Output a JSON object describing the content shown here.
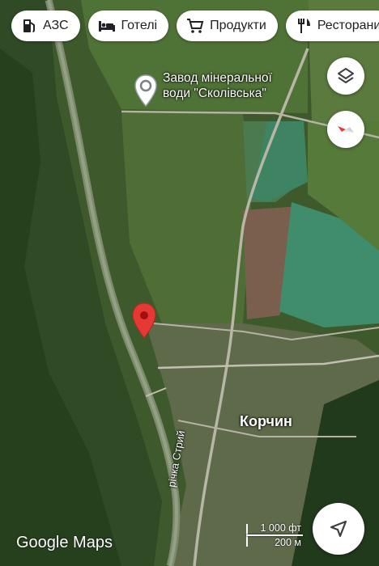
{
  "filters": [
    {
      "label": "АЗС",
      "icon": "gas-station-icon"
    },
    {
      "label": "Готелі",
      "icon": "bed-icon"
    },
    {
      "label": "Продукти",
      "icon": "shopping-cart-icon"
    },
    {
      "label": "Ресторани",
      "icon": "restaurant-icon"
    }
  ],
  "poi": {
    "line1": "Завод мінеральної",
    "line2": "води \"Сколівська\"",
    "icon": "place-icon"
  },
  "town": "Корчин",
  "river": "річка Стрий",
  "brand": "Google Maps",
  "scale": {
    "feet": "1 000 фт",
    "meters": "200 м"
  },
  "controls": {
    "layers": "layers-icon",
    "compass": "compass-icon",
    "navigate": "navigation-arrow-icon"
  },
  "pin": "dropped-pin-icon",
  "colors": {
    "pin": "#e53935",
    "compass_red": "#e53935"
  }
}
